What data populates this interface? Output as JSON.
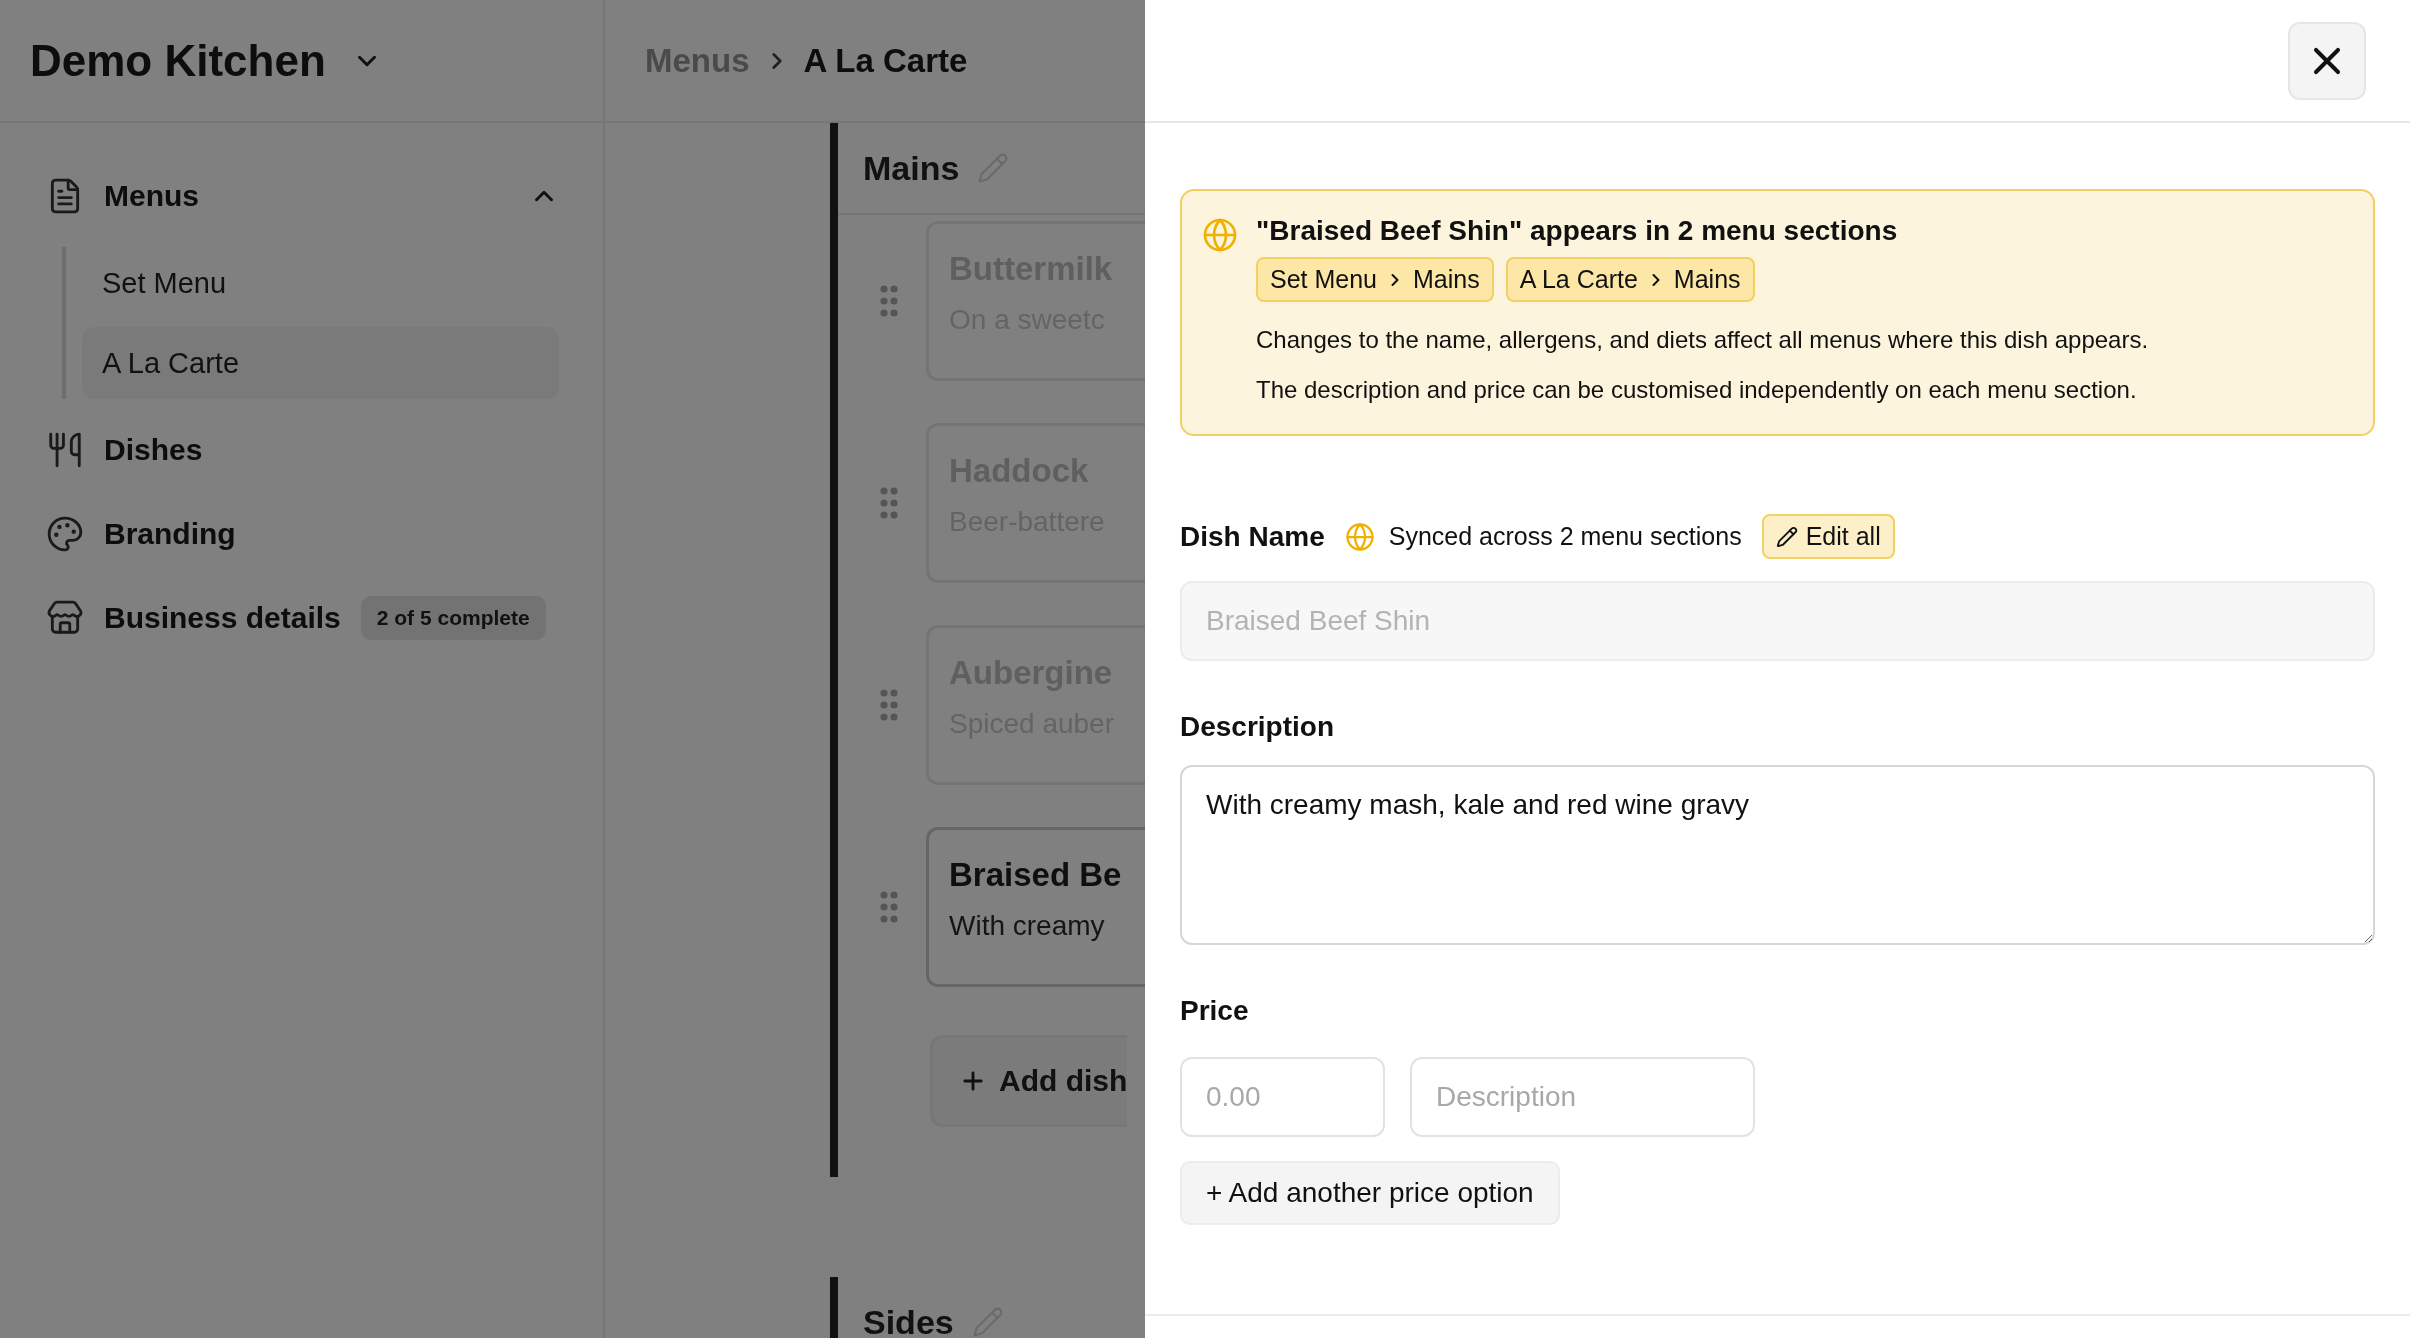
{
  "sidebar": {
    "workspace": "Demo Kitchen",
    "nav": [
      {
        "label": "Menus",
        "kind": "document",
        "expanded": true,
        "children": [
          {
            "label": "Set Menu",
            "selected": false
          },
          {
            "label": "A La Carte",
            "selected": true
          }
        ]
      },
      {
        "label": "Dishes",
        "kind": "utensils"
      },
      {
        "label": "Branding",
        "kind": "palette"
      },
      {
        "label": "Business details",
        "kind": "store",
        "badge": "2 of 5 complete"
      }
    ]
  },
  "breadcrumb": [
    "Menus",
    "A La Carte"
  ],
  "sections": [
    {
      "title": "Mains",
      "dishes": [
        {
          "name": "Buttermilk",
          "description": "On a sweetc",
          "active": false
        },
        {
          "name": "Haddock",
          "description": "Beer-battere",
          "active": false
        },
        {
          "name": "Aubergine",
          "description": "Spiced auber",
          "active": false
        },
        {
          "name": "Braised Be",
          "description": "With creamy",
          "active": true
        }
      ],
      "add_label": "Add dish"
    },
    {
      "title": "Sides"
    }
  ],
  "drawer": {
    "notice": {
      "title": "\"Braised Beef Shin\" appears in 2 menu sections",
      "paths": [
        [
          "Set Menu",
          "Mains"
        ],
        [
          "A La Carte",
          "Mains"
        ]
      ],
      "lines": [
        "Changes to the name, allergens, and diets affect all menus where this dish appears.",
        "The description and price can be customised independently on each menu section."
      ]
    },
    "dish_name": {
      "label": "Dish Name",
      "sync_note": "Synced across 2 menu sections",
      "edit_button": "Edit all",
      "value": "Braised Beef Shin",
      "disabled": true
    },
    "description": {
      "label": "Description",
      "value": "With creamy mash, kale and red wine gravy"
    },
    "price": {
      "label": "Price",
      "amount_placeholder": "0.00",
      "description_placeholder": "Description",
      "add_button": "+ Add another price option"
    }
  }
}
